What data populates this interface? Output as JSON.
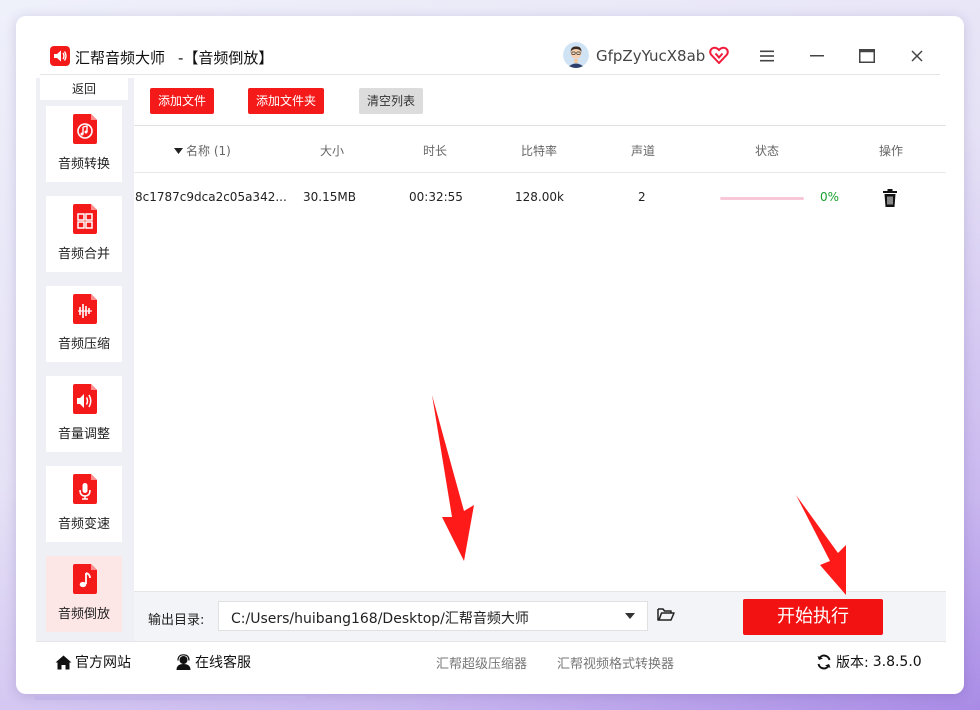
{
  "window": {
    "app_title": "汇帮音频大师",
    "page_title": "-【音频倒放】",
    "username": "GfpZyYucX8ab",
    "icons": {
      "app": "speaker-logo-icon",
      "vip": "heart-vip-icon",
      "menu": "hamburger-menu-icon",
      "minimize": "minimize-icon",
      "maximize": "maximize-icon",
      "close": "close-icon"
    }
  },
  "sidebar": {
    "back_label": "返回",
    "items": [
      {
        "label": "音频转换",
        "icon": "audio-convert-icon"
      },
      {
        "label": "音频合并",
        "icon": "audio-merge-icon"
      },
      {
        "label": "音频压缩",
        "icon": "audio-compress-icon"
      },
      {
        "label": "音量调整",
        "icon": "volume-adjust-icon"
      },
      {
        "label": "音频变速",
        "icon": "audio-speed-icon"
      },
      {
        "label": "音频倒放",
        "icon": "audio-reverse-icon",
        "active": true
      }
    ]
  },
  "toolbar": {
    "add_file": "添加文件",
    "add_folder": "添加文件夹",
    "clear_list": "清空列表"
  },
  "table": {
    "columns": [
      "名称 (1)",
      "大小",
      "时长",
      "比特率",
      "声道",
      "状态",
      "操作"
    ],
    "rows": [
      {
        "name": "8c1787c9dca2c05a342...",
        "size": "30.15MB",
        "duration": "00:32:55",
        "bitrate": "128.00k",
        "channels": "2",
        "progress": 0,
        "progress_text": "0%"
      }
    ]
  },
  "output": {
    "label": "输出目录:",
    "path": "C:/Users/huibang168/Desktop/汇帮音频大师",
    "start_label": "开始执行"
  },
  "footer": {
    "website": "官方网站",
    "support": "在线客服",
    "product1": "汇帮超级压缩器",
    "product2": "汇帮视频格式转换器",
    "version_label": "版本:",
    "version": "3.8.5.0"
  },
  "colors": {
    "accent": "#f51a1a",
    "active_bg": "#fde6e6",
    "progress_track": "#f9c8d8",
    "percent": "#19a030"
  }
}
